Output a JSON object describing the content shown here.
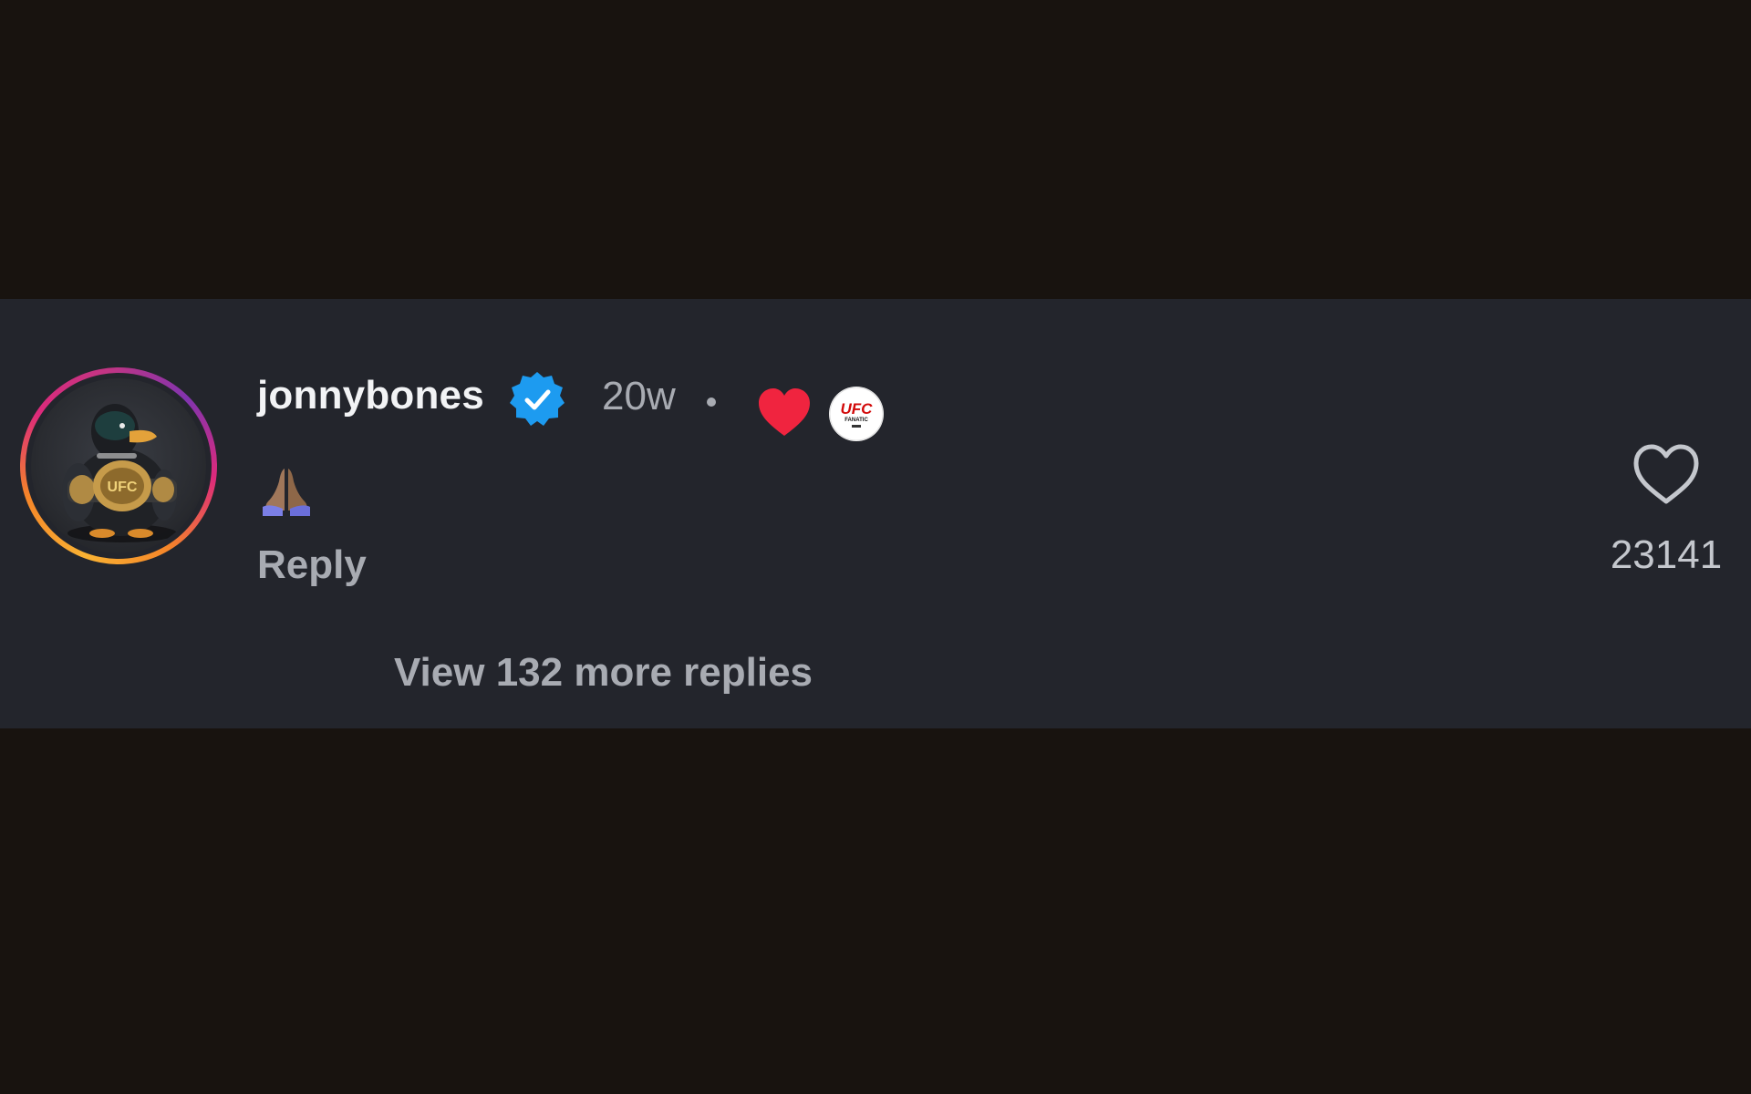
{
  "comment": {
    "username": "jonnybones",
    "verified": true,
    "timestamp": "20w",
    "separator": "•",
    "liked_by_creator": true,
    "creator_badge_icon": "ufc-fanatic-logo",
    "creator_badge_text": "UFC FANATIC",
    "text_emoji": "folded-hands-emoji",
    "reply_label": "Reply",
    "view_replies_label": "View 132 more replies",
    "like_count": "23141"
  },
  "colors": {
    "background": "#18130f",
    "comment_band": "#23252c",
    "username": "#f2f3f5",
    "muted_text": "#a8abb2",
    "verified_blue": "#1d9bf0",
    "heart_red": "#f0243f",
    "ufc_red": "#d20a0a"
  }
}
